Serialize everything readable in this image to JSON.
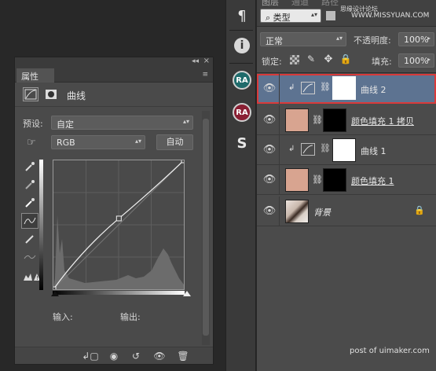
{
  "properties_panel": {
    "collapse_arrows": "◂◂",
    "tab_label": "属性",
    "type_label": "曲线",
    "preset_label": "预设:",
    "preset_value": "自定",
    "channel_value": "RGB",
    "auto_button": "自动",
    "input_label": "输入:",
    "output_label": "输出:"
  },
  "layers_panel": {
    "tabs": [
      "图层",
      "通道",
      "路径"
    ],
    "filter_kind": "类型",
    "blend_mode": "正常",
    "opacity_label": "不透明度:",
    "opacity_value": "100%",
    "lock_label": "锁定:",
    "fill_label": "填充:",
    "fill_value": "100%",
    "layers": [
      {
        "name": "曲线 2",
        "kind": "curves",
        "selected": true,
        "clipped": true
      },
      {
        "name": "颜色填充 1 拷贝",
        "kind": "fill",
        "selected": false,
        "clipped": false
      },
      {
        "name": "曲线 1",
        "kind": "curves",
        "selected": false,
        "clipped": true
      },
      {
        "name": "颜色填充 1",
        "kind": "fill",
        "selected": false,
        "clipped": false
      },
      {
        "name": "背景",
        "kind": "background",
        "selected": false,
        "clipped": false
      }
    ]
  },
  "watermarks": {
    "top": "WWW.MISSYUAN.COM",
    "top_cn": "思缘设计论坛",
    "bottom": "post of uimaker.com"
  },
  "colors": {
    "selected_outline": "#d93a3a",
    "selected_row": "#5d7391",
    "fill_swatch": "#d8a490"
  },
  "chart_data": {
    "type": "line",
    "xlim": [
      0,
      255
    ],
    "ylim": [
      0,
      255
    ],
    "curve_points": [
      [
        0,
        0
      ],
      [
        128,
        140
      ],
      [
        255,
        255
      ]
    ]
  }
}
